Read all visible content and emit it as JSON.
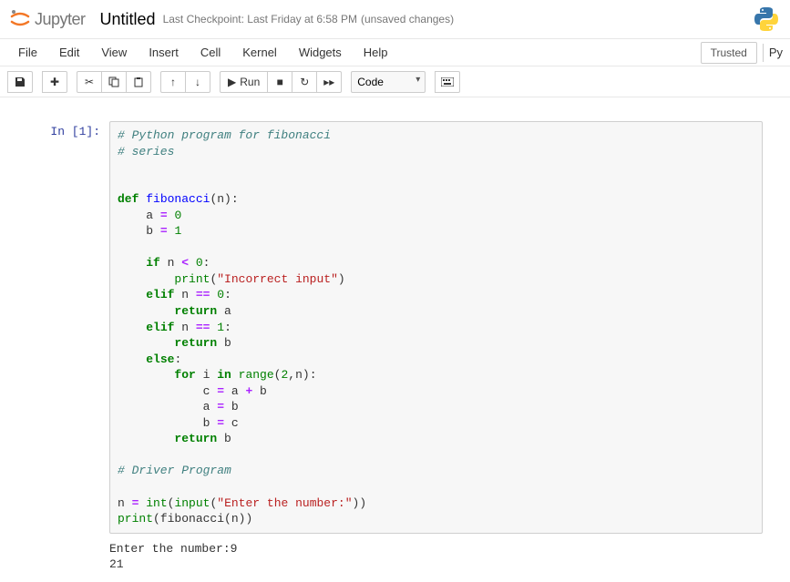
{
  "header": {
    "logo_text": "Jupyter",
    "title": "Untitled",
    "checkpoint": "Last Checkpoint: Last Friday at 6:58 PM",
    "unsaved": "(unsaved changes)"
  },
  "menubar": {
    "file": "File",
    "edit": "Edit",
    "view": "View",
    "insert": "Insert",
    "cell": "Cell",
    "kernel": "Kernel",
    "widgets": "Widgets",
    "help": "Help",
    "trusted": "Trusted",
    "kernel_name": "Py"
  },
  "toolbar": {
    "run_label": "Run",
    "cell_type": "Code"
  },
  "cell": {
    "prompt": "In [1]:",
    "code": {
      "c1": "# Python program for fibonacci",
      "c2": "# series",
      "c3": "# Driver Program",
      "kw_def": "def",
      "fn_name": "fibonacci",
      "kw_if": "if",
      "kw_elif": "elif",
      "kw_else": "else",
      "kw_for": "for",
      "kw_in": "in",
      "kw_return": "return",
      "bi_print": "print",
      "bi_range": "range",
      "bi_int": "int",
      "bi_input": "input",
      "s_incorrect": "\"Incorrect input\"",
      "s_enter": "\"Enter the number:\"",
      "num0": "0",
      "num1": "1",
      "num2": "2"
    },
    "output": "Enter the number:9\n21"
  }
}
